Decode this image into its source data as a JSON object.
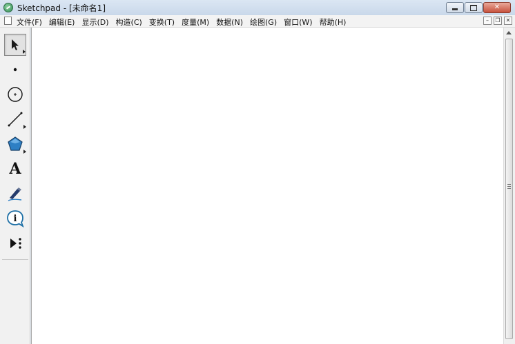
{
  "window": {
    "app_title": "Sketchpad",
    "document_title": "- [未命名1]"
  },
  "menubar": {
    "items": [
      "文件(F)",
      "编辑(E)",
      "显示(D)",
      "构造(C)",
      "变换(T)",
      "度量(M)",
      "数据(N)",
      "绘图(G)",
      "窗口(W)",
      "帮助(H)"
    ]
  },
  "toolbox": {
    "tools": [
      "selection-arrow-tool",
      "point-tool",
      "compass-tool",
      "straightedge-tool",
      "polygon-tool",
      "text-tool",
      "marker-tool",
      "information-tool",
      "custom-tools"
    ],
    "selected": "selection-arrow-tool",
    "text_tool_glyph": "A",
    "info_tool_glyph": "i"
  },
  "colors": {
    "titlebar": "#c9d8ea",
    "canvas": "#ffffff",
    "polygon_fill": "#2e7fc4"
  }
}
